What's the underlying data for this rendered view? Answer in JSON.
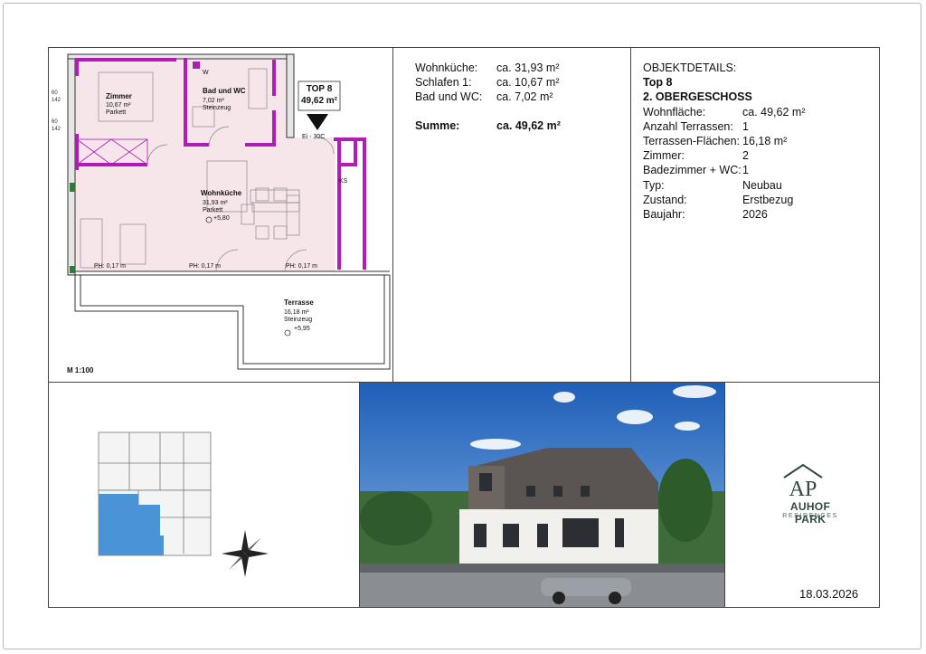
{
  "floorplan": {
    "scale_label": "M 1:100",
    "unit_tag": {
      "title": "TOP 8",
      "area": "49,62 m²"
    },
    "rooms": [
      {
        "name": "Zimmer",
        "area": "10,67 m²",
        "floor": "Parkett"
      },
      {
        "name": "Bad und WC",
        "area": "7,02 m²",
        "floor": "Steinzeug"
      },
      {
        "name": "Wohnküche",
        "area": "31,93 m²",
        "floor": "Parkett",
        "level": "+5,80"
      },
      {
        "name": "Terrasse",
        "area": "16,18 m²",
        "floor": "Steinzeug",
        "level": "+5,95"
      }
    ],
    "marks": {
      "w": "W",
      "ks": "KS",
      "ei": "Ei - 30C",
      "ph1": "PH: 0,17 m",
      "ph2": "PH: 0,17 m",
      "ph3": "PH: 0,17 m"
    }
  },
  "areas": {
    "rows": [
      {
        "label": "Wohnküche:",
        "value": "ca. 31,93 m²"
      },
      {
        "label": "Schlafen 1:",
        "value": "ca. 10,67 m²"
      },
      {
        "label": "Bad und WC:",
        "value": "ca.  7,02 m²"
      }
    ],
    "total": {
      "label": "Summe:",
      "value": "ca.  49,62 m²"
    }
  },
  "details": {
    "heading": "OBJEKTDETAILS:",
    "unit": "Top 8",
    "floor": "2. OBERGESCHOSS",
    "rows": [
      {
        "label": "Wohnfläche:",
        "value": "ca. 49,62 m²"
      },
      {
        "label": "Anzahl Terrassen:",
        "value": "1"
      },
      {
        "label": "Terrassen-Flächen:",
        "value": "16,18 m²"
      },
      {
        "label": "Zimmer:",
        "value": "2"
      },
      {
        "label": "Badezimmer + WC:",
        "value": "1"
      },
      {
        "label": "Typ:",
        "value": "Neubau"
      },
      {
        "label": "Zustand:",
        "value": "Erstbezug"
      },
      {
        "label": "Baujahr:",
        "value": "2026"
      }
    ]
  },
  "logo": {
    "monogram": "AP",
    "title": "AUHOF PARK",
    "subtitle": "RESIDENCES"
  },
  "date": "18.03.2026",
  "colors": {
    "wall_accent": "#b21bb8",
    "room_fill": "#f6e6ea",
    "highlight": "#4a93d6",
    "brand": "#2f4a3c"
  }
}
